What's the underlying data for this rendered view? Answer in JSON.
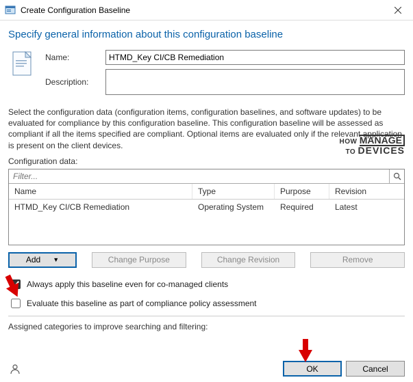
{
  "titlebar": {
    "title": "Create Configuration Baseline"
  },
  "heading": "Specify general information about this configuration baseline",
  "form": {
    "name_label": "Name:",
    "name_value": "HTMD_Key CI/CB Remediation",
    "desc_label": "Description:",
    "desc_value": ""
  },
  "instructions": "Select the configuration data (configuration items, configuration baselines, and software updates) to be evaluated for compliance by this configuration baseline. This configuration baseline will be assessed as compliant if all the items specified are compliant. Optional items are evaluated only if the relevant application is present on  the client devices.",
  "watermark": {
    "line1": "HOW",
    "line2": "MANAGE",
    "line3": "DEVICES",
    "to": "TO"
  },
  "cfg_label": "Configuration data:",
  "filter_placeholder": "Filter...",
  "columns": {
    "c1": "Name",
    "c2": "Type",
    "c3": "Purpose",
    "c4": "Revision"
  },
  "rows": [
    {
      "name": "HTMD_Key CI/CB Remediation",
      "type": "Operating System",
      "purpose": "Required",
      "revision": "Latest"
    }
  ],
  "buttons": {
    "add": "Add",
    "change_purpose": "Change Purpose",
    "change_revision": "Change Revision",
    "remove": "Remove"
  },
  "checkboxes": {
    "always_apply": "Always apply this baseline even for co-managed clients",
    "evaluate": "Evaluate this baseline as part of compliance policy assessment"
  },
  "categories_label": "Assigned categories to improve searching and filtering:",
  "footer": {
    "ok": "OK",
    "cancel": "Cancel"
  }
}
